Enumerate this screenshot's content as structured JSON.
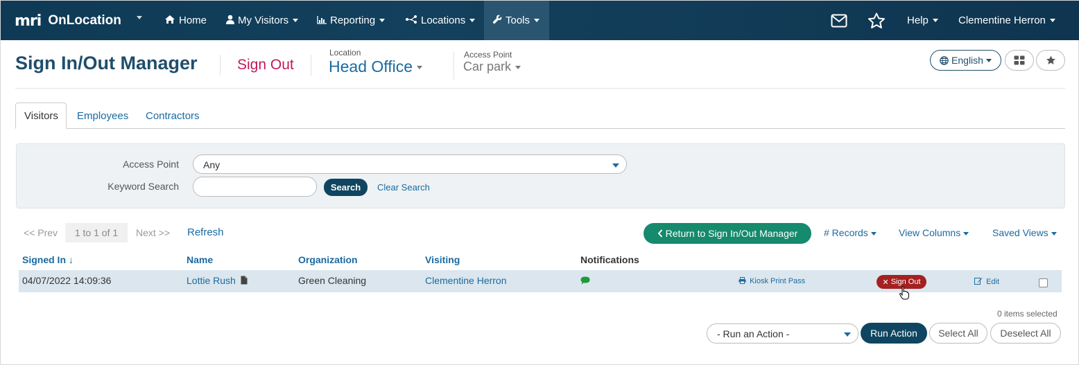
{
  "navbar": {
    "brand_mark": "mri",
    "brand_name": "OnLocation",
    "items": [
      {
        "label": "Home",
        "icon": "home-icon"
      },
      {
        "label": "My Visitors",
        "icon": "user-icon"
      },
      {
        "label": "Reporting",
        "icon": "bar-chart-icon"
      },
      {
        "label": "Locations",
        "icon": "network-icon"
      },
      {
        "label": "Tools",
        "icon": "wrench-icon"
      }
    ],
    "active_item": "Tools",
    "help_label": "Help",
    "user_name": "Clementine Herron",
    "bg_color": "#0e3a55"
  },
  "header": {
    "title": "Sign In/Out Manager",
    "sign_out_label": "Sign Out",
    "location_label": "Location",
    "location_value": "Head Office",
    "access_point_label": "Access Point",
    "access_point_value": "Car park",
    "language_label": "English"
  },
  "tabs": [
    {
      "label": "Visitors",
      "active": true
    },
    {
      "label": "Employees",
      "active": false
    },
    {
      "label": "Contractors",
      "active": false
    }
  ],
  "search": {
    "access_point_label": "Access Point",
    "access_point_value": "Any",
    "keyword_label": "Keyword Search",
    "keyword_value": "",
    "search_button": "Search",
    "clear_link": "Clear Search"
  },
  "pager": {
    "prev": "<< Prev",
    "count": "1 to 1 of 1",
    "next": "Next >>",
    "refresh": "Refresh"
  },
  "toolbar": {
    "return_button": "Return to Sign In/Out Manager",
    "records": "# Records",
    "view_columns": "View Columns",
    "saved_views": "Saved Views"
  },
  "table": {
    "columns": {
      "signed_in": "Signed In ↓",
      "name": "Name",
      "organization": "Organization",
      "visiting": "Visiting",
      "notifications": "Notifications"
    },
    "rows": [
      {
        "signed_in": "04/07/2022 14:09:36",
        "name": "Lottie Rush",
        "organization": "Green Cleaning",
        "visiting": "Clementine Herron",
        "kiosk_print": "Kiosk Print Pass",
        "sign_out": "Sign Out",
        "edit": "Edit"
      }
    ]
  },
  "footer": {
    "items_selected": "0 items selected",
    "action_placeholder": "- Run an Action -",
    "run_action": "Run Action",
    "select_all": "Select All",
    "deselect_all": "Deselect All"
  }
}
